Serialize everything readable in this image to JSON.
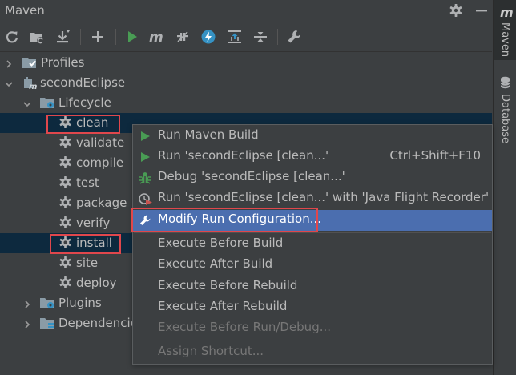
{
  "panel": {
    "title": "Maven"
  },
  "toolbar": {
    "buttons": [
      {
        "name": "reload-all-projects",
        "icon": "refresh-icon"
      },
      {
        "name": "generate-sources",
        "icon": "folder-refresh-icon"
      },
      {
        "name": "download-sources",
        "icon": "download-icon"
      },
      {
        "name": "add-maven-project",
        "icon": "plus-icon"
      },
      {
        "name": "run-maven-build",
        "icon": "play-icon"
      },
      {
        "name": "execute-maven-goal",
        "icon": "maven-m-icon"
      },
      {
        "name": "toggle-offline-mode",
        "icon": "offline-icon"
      },
      {
        "name": "skip-tests",
        "icon": "lightning-icon"
      },
      {
        "name": "show-dependencies",
        "icon": "dependencies-icon"
      },
      {
        "name": "collapse-all",
        "icon": "collapse-icon"
      },
      {
        "name": "maven-settings",
        "icon": "wrench-icon"
      }
    ]
  },
  "tree": {
    "profiles": "Profiles",
    "project": "secondEclipse",
    "lifecycle": "Lifecycle",
    "goals": [
      "clean",
      "validate",
      "compile",
      "test",
      "package",
      "verify",
      "install",
      "site",
      "deploy"
    ],
    "plugins": "Plugins",
    "dependencies": "Dependencies"
  },
  "stripe": {
    "maven_letter": "m",
    "maven_label": "Maven",
    "database_label": "Database"
  },
  "menu": {
    "items": [
      {
        "label": "Run Maven Build",
        "shortcut": "",
        "icon": "run-icon"
      },
      {
        "label": "Run 'secondEclipse [clean...'",
        "shortcut": "Ctrl+Shift+F10",
        "icon": "run-icon"
      },
      {
        "label": "Debug 'secondEclipse [clean...'",
        "shortcut": "",
        "icon": "debug-icon"
      },
      {
        "label": "Run 'secondEclipse [clean...' with 'Java Flight Recorder'",
        "shortcut": "",
        "icon": "profiler-icon"
      },
      {
        "label": "Modify Run Configuration...",
        "shortcut": "",
        "icon": "wrench-icon"
      },
      {
        "label": "Execute Before Build",
        "shortcut": ""
      },
      {
        "label": "Execute After Build",
        "shortcut": ""
      },
      {
        "label": "Execute Before Rebuild",
        "shortcut": ""
      },
      {
        "label": "Execute After Rebuild",
        "shortcut": ""
      },
      {
        "label": "Execute Before Run/Debug...",
        "shortcut": ""
      },
      {
        "label": "Assign Shortcut...",
        "shortcut": ""
      }
    ]
  },
  "colors": {
    "background": "#3c3f41",
    "selection": "#0d293e",
    "menu_highlight": "#4b6eaf",
    "run_green": "#499c54",
    "annotation_red": "#e0474c",
    "skip_tests_blue": "#3592c4"
  }
}
